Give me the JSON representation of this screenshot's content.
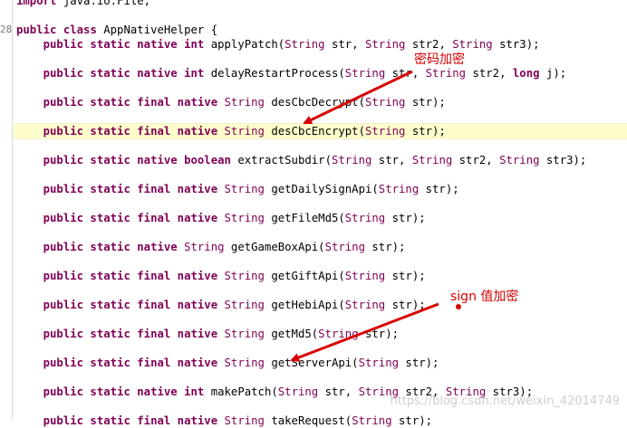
{
  "editor": {
    "line_number": "28",
    "lines": [
      {
        "tokens": [
          {
            "t": "import ",
            "k": "kw"
          },
          {
            "t": "java.io.File;",
            "k": "plain"
          }
        ]
      },
      {
        "tokens": []
      },
      {
        "tokens": [
          {
            "t": "public ",
            "k": "kw"
          },
          {
            "t": "class ",
            "k": "kw"
          },
          {
            "t": "AppNativeHelper {",
            "k": "plain"
          }
        ]
      },
      {
        "tokens": [
          {
            "t": "    public static native ",
            "k": "kw"
          },
          {
            "t": "int ",
            "k": "kw"
          },
          {
            "t": "applyPatch(",
            "k": "plain"
          },
          {
            "t": "String",
            "k": "ty"
          },
          {
            "t": " str, ",
            "k": "plain"
          },
          {
            "t": "String",
            "k": "ty"
          },
          {
            "t": " str2, ",
            "k": "plain"
          },
          {
            "t": "String",
            "k": "ty"
          },
          {
            "t": " str3);",
            "k": "plain"
          }
        ]
      },
      {
        "tokens": []
      },
      {
        "tokens": [
          {
            "t": "    public static native ",
            "k": "kw"
          },
          {
            "t": "int ",
            "k": "kw"
          },
          {
            "t": "delayRestartProcess(",
            "k": "plain"
          },
          {
            "t": "String",
            "k": "ty"
          },
          {
            "t": " str, ",
            "k": "plain"
          },
          {
            "t": "String",
            "k": "ty"
          },
          {
            "t": " str2, ",
            "k": "plain"
          },
          {
            "t": "long",
            "k": "kw"
          },
          {
            "t": " j);",
            "k": "plain"
          }
        ]
      },
      {
        "tokens": []
      },
      {
        "tokens": [
          {
            "t": "    public static final native ",
            "k": "kw"
          },
          {
            "t": "String",
            "k": "ty"
          },
          {
            "t": " desCbcDecrypt(",
            "k": "plain"
          },
          {
            "t": "String",
            "k": "ty"
          },
          {
            "t": " str);",
            "k": "plain"
          }
        ]
      },
      {
        "tokens": []
      },
      {
        "tokens": [
          {
            "t": "    public static final native ",
            "k": "kw"
          },
          {
            "t": "String",
            "k": "ty"
          },
          {
            "t": " desCbcEncrypt(",
            "k": "plain"
          },
          {
            "t": "String",
            "k": "ty"
          },
          {
            "t": " str);",
            "k": "plain"
          }
        ],
        "highlight": true
      },
      {
        "tokens": []
      },
      {
        "tokens": [
          {
            "t": "    public static native ",
            "k": "kw"
          },
          {
            "t": "boolean",
            "k": "kw"
          },
          {
            "t": " extractSubdir(",
            "k": "plain"
          },
          {
            "t": "String",
            "k": "ty"
          },
          {
            "t": " str, ",
            "k": "plain"
          },
          {
            "t": "String",
            "k": "ty"
          },
          {
            "t": " str2, ",
            "k": "plain"
          },
          {
            "t": "String",
            "k": "ty"
          },
          {
            "t": " str3);",
            "k": "plain"
          }
        ]
      },
      {
        "tokens": []
      },
      {
        "tokens": [
          {
            "t": "    public static final native ",
            "k": "kw"
          },
          {
            "t": "String",
            "k": "ty"
          },
          {
            "t": " getDailySignApi(",
            "k": "plain"
          },
          {
            "t": "String",
            "k": "ty"
          },
          {
            "t": " str);",
            "k": "plain"
          }
        ]
      },
      {
        "tokens": []
      },
      {
        "tokens": [
          {
            "t": "    public static final native ",
            "k": "kw"
          },
          {
            "t": "String",
            "k": "ty"
          },
          {
            "t": " getFileMd5(",
            "k": "plain"
          },
          {
            "t": "String",
            "k": "ty"
          },
          {
            "t": " str);",
            "k": "plain"
          }
        ]
      },
      {
        "tokens": []
      },
      {
        "tokens": [
          {
            "t": "    public static native ",
            "k": "kw"
          },
          {
            "t": "String",
            "k": "ty"
          },
          {
            "t": " getGameBoxApi(",
            "k": "plain"
          },
          {
            "t": "String",
            "k": "ty"
          },
          {
            "t": " str);",
            "k": "plain"
          }
        ]
      },
      {
        "tokens": []
      },
      {
        "tokens": [
          {
            "t": "    public static final native ",
            "k": "kw"
          },
          {
            "t": "String",
            "k": "ty"
          },
          {
            "t": " getGiftApi(",
            "k": "plain"
          },
          {
            "t": "String",
            "k": "ty"
          },
          {
            "t": " str);",
            "k": "plain"
          }
        ]
      },
      {
        "tokens": []
      },
      {
        "tokens": [
          {
            "t": "    public static final native ",
            "k": "kw"
          },
          {
            "t": "String",
            "k": "ty"
          },
          {
            "t": " getHebiApi(",
            "k": "plain"
          },
          {
            "t": "String",
            "k": "ty"
          },
          {
            "t": " str);",
            "k": "plain"
          }
        ]
      },
      {
        "tokens": []
      },
      {
        "tokens": [
          {
            "t": "    public static final native ",
            "k": "kw"
          },
          {
            "t": "String",
            "k": "ty"
          },
          {
            "t": " getMd5(",
            "k": "plain"
          },
          {
            "t": "String",
            "k": "ty"
          },
          {
            "t": " str);",
            "k": "plain"
          }
        ]
      },
      {
        "tokens": []
      },
      {
        "tokens": [
          {
            "t": "    public static final native ",
            "k": "kw"
          },
          {
            "t": "String",
            "k": "ty"
          },
          {
            "t": " getServerApi(",
            "k": "plain"
          },
          {
            "t": "String",
            "k": "ty"
          },
          {
            "t": " str);",
            "k": "plain"
          }
        ]
      },
      {
        "tokens": []
      },
      {
        "tokens": [
          {
            "t": "    public static native ",
            "k": "kw"
          },
          {
            "t": "int ",
            "k": "kw"
          },
          {
            "t": "makePatch(",
            "k": "plain"
          },
          {
            "t": "String",
            "k": "ty"
          },
          {
            "t": " str, ",
            "k": "plain"
          },
          {
            "t": "String",
            "k": "ty"
          },
          {
            "t": " str2, ",
            "k": "plain"
          },
          {
            "t": "String",
            "k": "ty"
          },
          {
            "t": " str3);",
            "k": "plain"
          }
        ]
      },
      {
        "tokens": []
      },
      {
        "tokens": [
          {
            "t": "    public static final native ",
            "k": "kw"
          },
          {
            "t": "String",
            "k": "ty"
          },
          {
            "t": " takeRequest(",
            "k": "plain"
          },
          {
            "t": "String",
            "k": "ty"
          },
          {
            "t": " str);",
            "k": "plain"
          }
        ]
      }
    ]
  },
  "annotations": {
    "password_label": "密码加密",
    "sign_label": "sign 值加密"
  },
  "watermark": "https://blog.csdn.net/weixin_42014749",
  "colors": {
    "keyword": "#7f0055",
    "highlight_line": "#ffffcc",
    "annotation": "#d90000"
  }
}
